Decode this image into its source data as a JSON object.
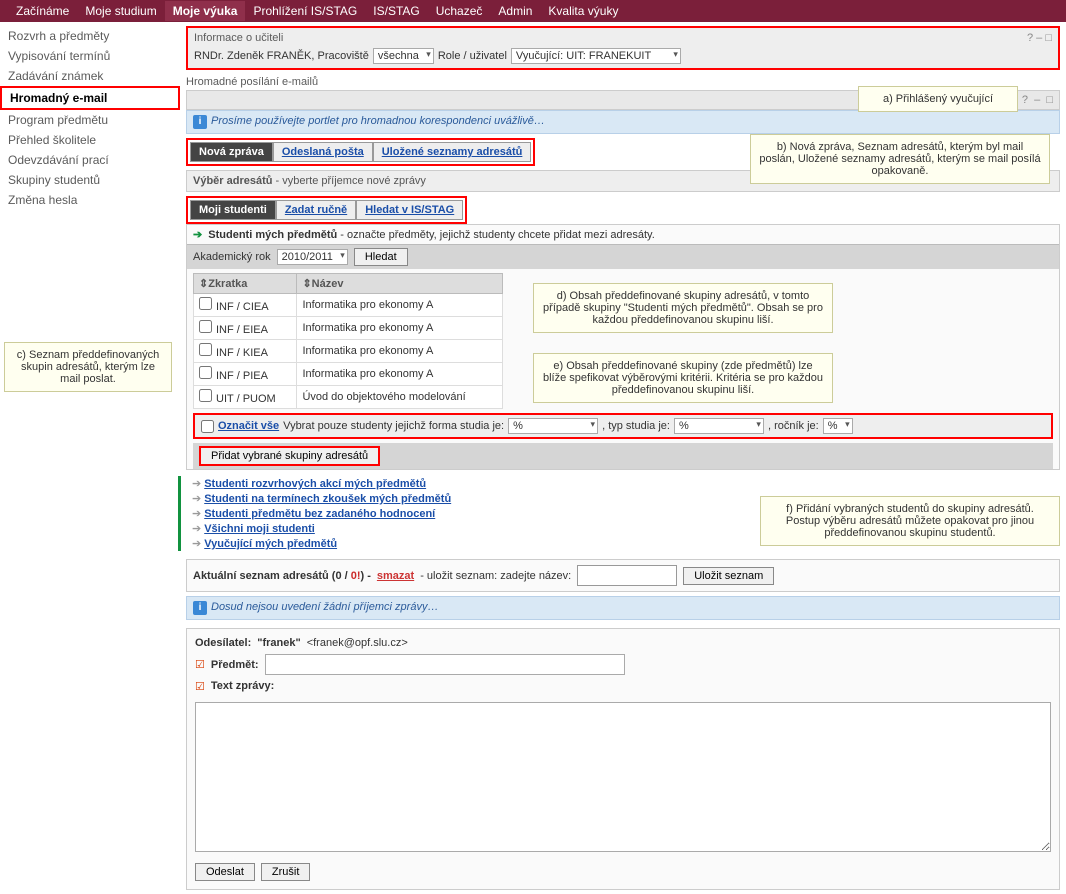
{
  "topnav": {
    "items": [
      "Začínáme",
      "Moje studium",
      "Moje výuka",
      "Prohlížení IS/STAG",
      "IS/STAG",
      "Uchazeč",
      "Admin",
      "Kvalita výuky"
    ],
    "active": 2
  },
  "sidebar": {
    "items": [
      "Rozvrh a předměty",
      "Vypisování termínů",
      "Zadávání známek",
      "Hromadný e-mail",
      "Program předmětu",
      "Přehled školitele",
      "Odevzdávání prací",
      "Skupiny studentů",
      "Změna hesla"
    ],
    "active": 3
  },
  "teacher_portlet": {
    "title": "Informace o učiteli",
    "name_label": "RNDr. Zdeněk FRANĚK, Pracoviště",
    "workplace": "všechna",
    "role_label": "Role / uživatel",
    "role_value": "Vyučující: UIT: FRANEKUIT"
  },
  "section": {
    "title": "Hromadné posílání e-mailů",
    "info": "Prosíme používejte portlet pro hromadnou korespondenci uvážlivě…"
  },
  "tabs1": {
    "items": [
      "Nová zpráva",
      "Odeslaná pošta",
      "Uložené seznamy adresátů"
    ],
    "active": 0
  },
  "vyber_head": {
    "bold": "Výběr adresátů",
    "light": " - vyberte příjemce nové zprávy"
  },
  "tabs2": {
    "items": [
      "Moji studenti",
      "Zadat ručně",
      "Hledat v IS/STAG"
    ],
    "active": 0
  },
  "studenti_line": {
    "bold": "Studenti mých předmětů",
    "rest": " - označte předměty, jejichž studenty chcete přidat mezi adresáty."
  },
  "ak_row": {
    "label": "Akademický rok",
    "value": "2010/2011",
    "btn": "Hledat"
  },
  "table": {
    "headers": [
      "Zkratka",
      "Název"
    ],
    "rows": [
      {
        "zkr": "INF / CIEA",
        "naz": "Informatika pro ekonomy A"
      },
      {
        "zkr": "INF / EIEA",
        "naz": "Informatika pro ekonomy A"
      },
      {
        "zkr": "INF / KIEA",
        "naz": "Informatika pro ekonomy A"
      },
      {
        "zkr": "INF / PIEA",
        "naz": "Informatika pro ekonomy A"
      },
      {
        "zkr": "UIT / PUOM",
        "naz": "Úvod do objektového modelování"
      }
    ]
  },
  "filter": {
    "oznacit": "Označit vše",
    "text1": "Vybrat pouze studenty jejichž forma studia je:",
    "val": "%",
    "text2": ", typ studia je:",
    "text3": ", ročník je:"
  },
  "add_btn": "Přidat vybrané skupiny adresátů",
  "groups": [
    "Studenti rozvrhových akcí mých předmětů",
    "Studenti na termínech zkoušek mých předmětů",
    "Studenti předmětu bez zadaného hodnocení",
    "Všichni moji studenti",
    "Vyučující mých předmětů"
  ],
  "seznam": {
    "prefix": "Aktuální seznam adresátů (",
    "zero": "0",
    "slash": " / ",
    "zero_warn": "0!",
    "suffix": ") - ",
    "smazat": "smazat",
    "ulozit_text": " - uložit seznam: zadejte název: ",
    "save_btn": "Uložit seznam"
  },
  "no_recipients": "Dosud nejsou uvedení žádní příjemci zprávy…",
  "compose": {
    "from_label": "Odesílatel:",
    "from_name": "\"franek\"",
    "from_email": "<franek@opf.slu.cz>",
    "subject_label": "Předmět:",
    "body_label": "Text zprávy:",
    "send": "Odeslat",
    "cancel": "Zrušit"
  },
  "callouts": {
    "a": "a) Přihlášený vyučující",
    "b": "b) Nová zpráva, Seznam adresátů, kterým byl mail poslán, Uložené seznamy adresátů, kterým se mail posílá opakovaně.",
    "c": "c) Seznam předdefinovaných skupin adresátů, kterým lze mail poslat.",
    "d": "d) Obsah předdefinované skupiny adresátů, v tomto případě skupiny \"Studenti mých předmětů\". Obsah se pro každou předdefinovanou skupinu liší.",
    "e": "e) Obsah předdefinované skupiny (zde předmětů) lze blíže spefikovat výběrovými kritérii. Kritéria se pro každou předdefinovanou skupinu liší.",
    "f": "f) Přidání vybraných studentů do skupiny adresátů. Postup výběru adresátů můžete opakovat pro jinou předdefinovanou skupinu studentů."
  },
  "win": {
    "help": "?",
    "min": "–",
    "close": "□"
  }
}
